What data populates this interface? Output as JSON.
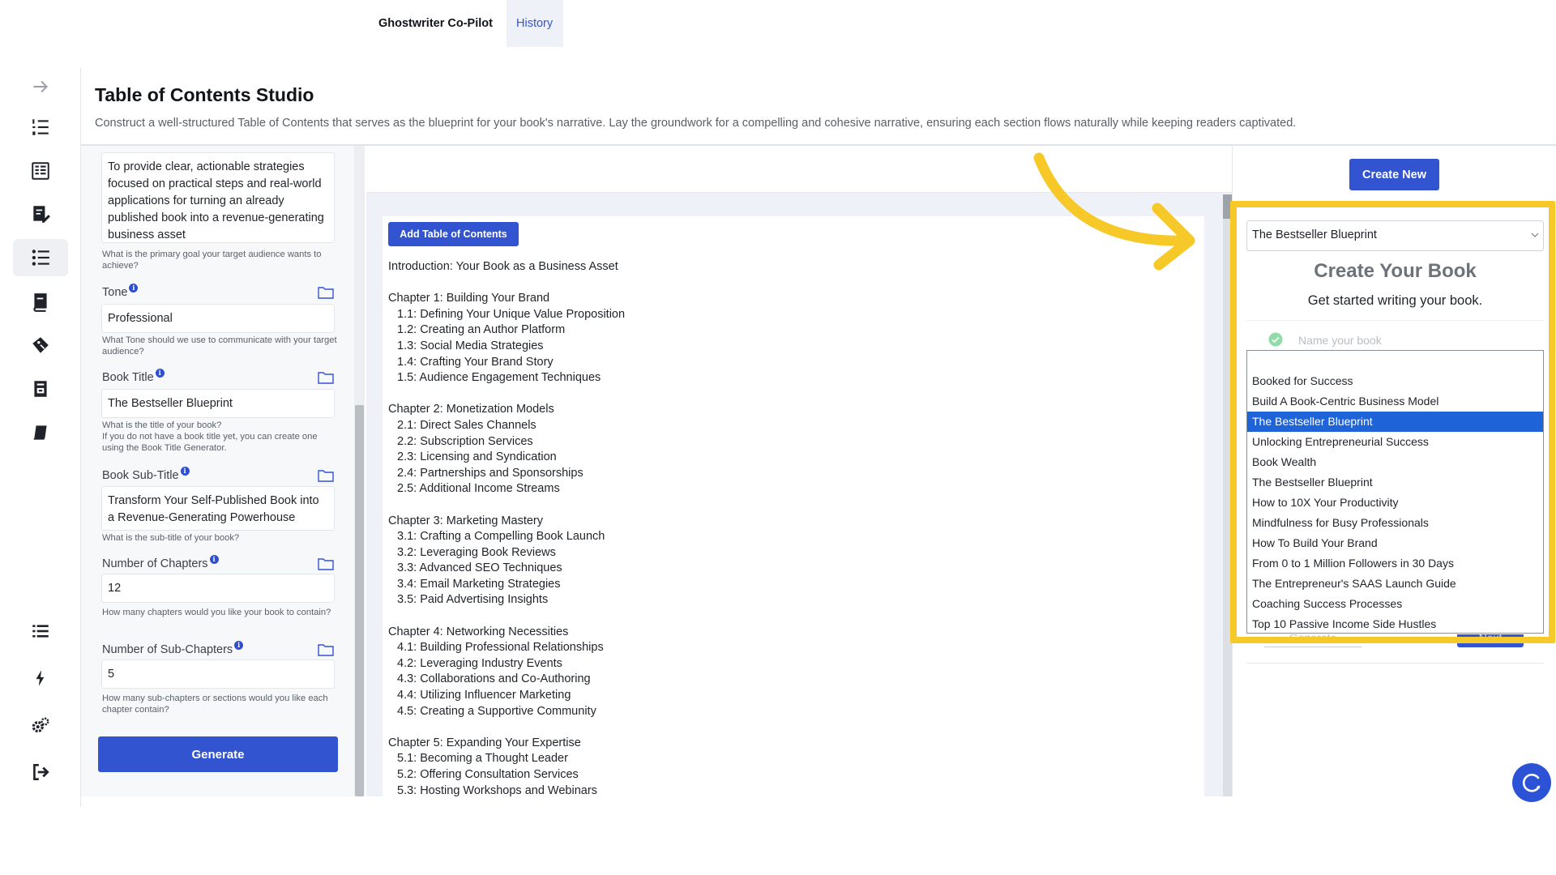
{
  "header": {
    "title": "Table of Contents Studio",
    "subtitle": "Construct a well-structured Table of Contents that serves as the blueprint for your book's narrative. Lay the groundwork for a compelling and cohesive narrative, ensuring each section flows naturally while keeping readers captivated."
  },
  "sidebar": {
    "items": [
      {
        "icon": "arrow-right-icon"
      },
      {
        "icon": "numbered-list-icon"
      },
      {
        "icon": "book-layout-icon"
      },
      {
        "icon": "document-edit-icon"
      },
      {
        "icon": "table-of-contents-icon",
        "active": true
      },
      {
        "icon": "book-stack-icon"
      },
      {
        "icon": "tag-icon"
      },
      {
        "icon": "print-icon"
      },
      {
        "icon": "notebook-icon"
      },
      {
        "icon": "list-icon"
      },
      {
        "icon": "lightning-icon"
      },
      {
        "icon": "settings-icon"
      },
      {
        "icon": "logout-icon"
      }
    ]
  },
  "form": {
    "goal_value": "To provide clear, actionable strategies focused on practical steps and real-world applications for turning an already published book into a revenue-generating business asset",
    "goal_help": "What is the primary goal your target audience wants to achieve?",
    "tone_label": "Tone",
    "tone_value": "Professional",
    "tone_help": "What Tone should we use to communicate with your target audience?",
    "title_label": "Book Title",
    "title_value": "The Bestseller Blueprint",
    "title_help": "What is the title of your book?\nIf you do not have a book title yet, you can create one using the Book Title Generator.",
    "subtitle_label": "Book Sub-Title",
    "subtitle_value": "Transform Your Self-Published Book into a Revenue-Generating Powerhouse",
    "subtitle_help": "What is the sub-title of your book?",
    "chapters_label": "Number of Chapters",
    "chapters_value": "12",
    "chapters_help": "How many chapters would you like your book to contain?",
    "subchapters_label": "Number of Sub-Chapters",
    "subchapters_value": "5",
    "subchapters_help": "How many sub-chapters or sections would you like each chapter contain?",
    "info_glyph": "i",
    "generate_label": "Generate"
  },
  "tabs": {
    "ghostwriter": "Ghostwriter Co-Pilot",
    "history": "History"
  },
  "editor": {
    "add_toc_label": "Add Table of Contents",
    "intro": "Introduction: Your Book as a Business Asset",
    "chapters": [
      {
        "title": "Chapter 1: Building Your Brand",
        "subs": [
          "1.1: Defining Your Unique Value Proposition",
          "1.2: Creating an Author Platform",
          "1.3: Social Media Strategies",
          "1.4: Crafting Your Brand Story",
          "1.5: Audience Engagement Techniques"
        ]
      },
      {
        "title": "Chapter 2: Monetization Models",
        "subs": [
          "2.1: Direct Sales Channels",
          "2.2: Subscription Services",
          "2.3: Licensing and Syndication",
          "2.4: Partnerships and Sponsorships",
          "2.5: Additional Income Streams"
        ]
      },
      {
        "title": "Chapter 3: Marketing Mastery",
        "subs": [
          "3.1: Crafting a Compelling Book Launch",
          "3.2: Leveraging Book Reviews",
          "3.3: Advanced SEO Techniques",
          "3.4: Email Marketing Strategies",
          "3.5: Paid Advertising Insights"
        ]
      },
      {
        "title": "Chapter 4: Networking Necessities",
        "subs": [
          "4.1: Building Professional Relationships",
          "4.2: Leveraging Industry Events",
          "4.3: Collaborations and Co-Authoring",
          "4.4: Utilizing Influencer Marketing",
          "4.5: Creating a Supportive Community"
        ]
      },
      {
        "title": "Chapter 5: Expanding Your Expertise",
        "subs": [
          "5.1: Becoming a Thought Leader",
          "5.2: Offering Consultation Services",
          "5.3: Hosting Workshops and Webinars"
        ]
      }
    ]
  },
  "right_panel": {
    "create_new_label": "Create New",
    "select_value": "The Bestseller Blueprint",
    "heading": "Create Your Book",
    "subheading": "Get started writing your book.",
    "name_placeholder": "Name your book",
    "options": [
      "Booked for Success",
      "Build A Book-Centric Business Model",
      "The Bestseller Blueprint",
      "Unlocking Entrepreneurial Success",
      "Book Wealth",
      "The Bestseller Blueprint",
      "How to 10X Your Productivity",
      "Mindfulness for Busy Professionals",
      "How To Build Your Brand",
      "From 0 to 1 Million Followers in 30 Days",
      "The Entrepreneur's SAAS Launch Guide",
      "Coaching Success Processes",
      "Top 10 Passive Income Side Hustles"
    ],
    "selected_index": 2,
    "hidden_generate_label": "Generate",
    "hidden_next_label": "Next"
  },
  "colors": {
    "primary": "#3354d1",
    "highlight": "#f7c928",
    "selected_option": "#1f63d9",
    "check": "#8fdca8"
  }
}
